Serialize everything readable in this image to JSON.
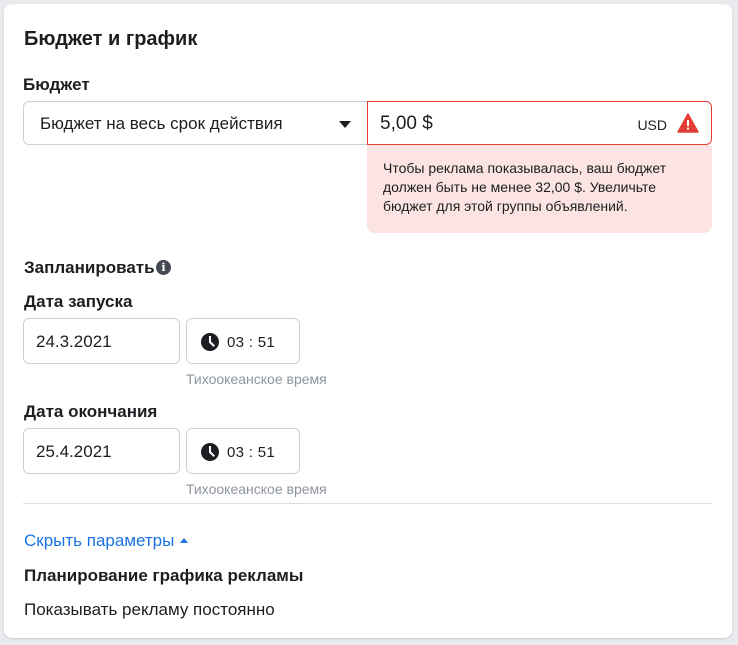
{
  "section": {
    "title": "Бюджет и график"
  },
  "budget": {
    "label": "Бюджет",
    "type_selected": "Бюджет на весь срок действия",
    "amount": "5,00 $",
    "currency": "USD",
    "error_message": "Чтобы реклама показывалась, ваш бюджет должен быть не менее 32,00 $. Увеличьте бюджет для этой группы объявлений."
  },
  "schedule": {
    "label": "Запланировать",
    "info_icon_glyph": "i",
    "start": {
      "label": "Дата запуска",
      "date": "24.3.2021",
      "time_hours": "03",
      "time_sep": ":",
      "time_minutes": "51",
      "timezone": "Тихоокеанское время"
    },
    "end": {
      "label": "Дата окончания",
      "date": "25.4.2021",
      "time_hours": "03",
      "time_sep": ":",
      "time_minutes": "51",
      "timezone": "Тихоокеанское время"
    }
  },
  "toggle": {
    "label": "Скрыть параметры"
  },
  "ad_scheduling": {
    "title": "Планирование графика рекламы",
    "value": "Показывать рекламу постоянно"
  },
  "colors": {
    "error": "#e33e35",
    "error_bg": "#fbe4e2",
    "link": "#1b74e4",
    "muted": "#8d949e"
  },
  "icons": {
    "caret": "caret-down-icon",
    "warning": "warning-icon",
    "info": "info-icon",
    "clock": "clock-icon",
    "toggle": "caret-up-icon"
  }
}
